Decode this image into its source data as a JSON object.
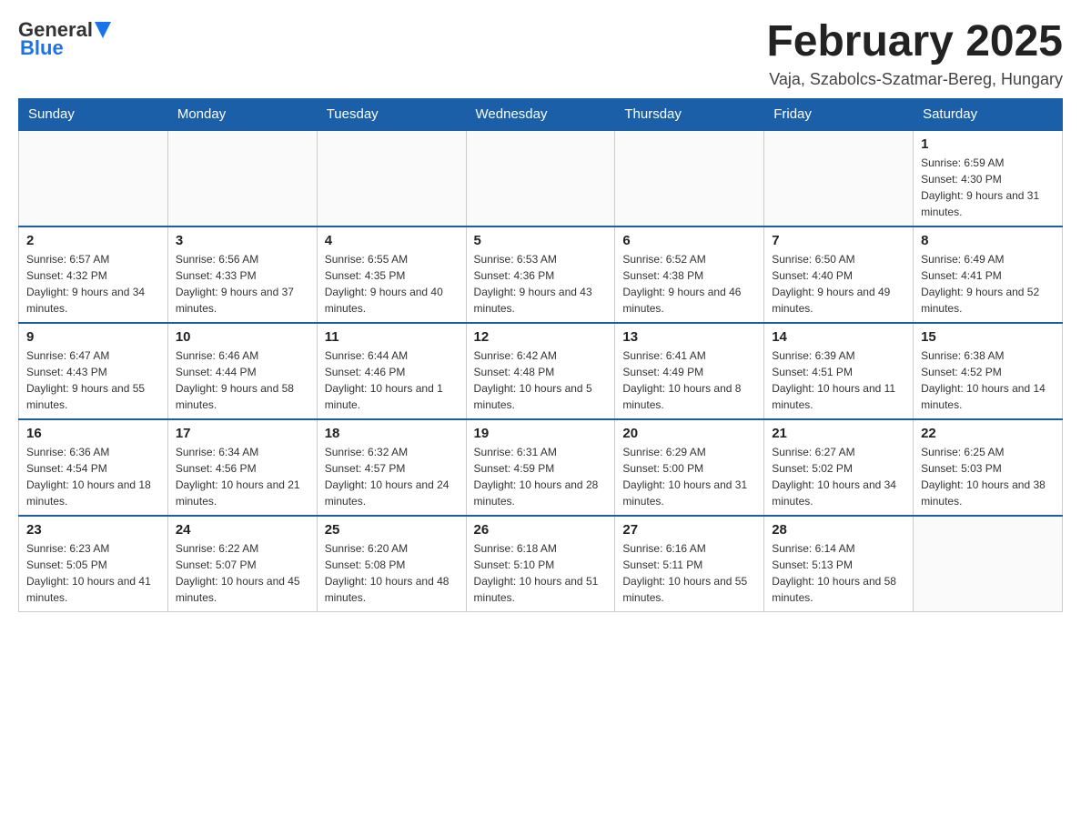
{
  "header": {
    "logo": {
      "general": "General",
      "blue": "Blue"
    },
    "title": "February 2025",
    "location": "Vaja, Szabolcs-Szatmar-Bereg, Hungary"
  },
  "days_of_week": [
    "Sunday",
    "Monday",
    "Tuesday",
    "Wednesday",
    "Thursday",
    "Friday",
    "Saturday"
  ],
  "weeks": [
    [
      {
        "day": "",
        "info": ""
      },
      {
        "day": "",
        "info": ""
      },
      {
        "day": "",
        "info": ""
      },
      {
        "day": "",
        "info": ""
      },
      {
        "day": "",
        "info": ""
      },
      {
        "day": "",
        "info": ""
      },
      {
        "day": "1",
        "info": "Sunrise: 6:59 AM\nSunset: 4:30 PM\nDaylight: 9 hours and 31 minutes."
      }
    ],
    [
      {
        "day": "2",
        "info": "Sunrise: 6:57 AM\nSunset: 4:32 PM\nDaylight: 9 hours and 34 minutes."
      },
      {
        "day": "3",
        "info": "Sunrise: 6:56 AM\nSunset: 4:33 PM\nDaylight: 9 hours and 37 minutes."
      },
      {
        "day": "4",
        "info": "Sunrise: 6:55 AM\nSunset: 4:35 PM\nDaylight: 9 hours and 40 minutes."
      },
      {
        "day": "5",
        "info": "Sunrise: 6:53 AM\nSunset: 4:36 PM\nDaylight: 9 hours and 43 minutes."
      },
      {
        "day": "6",
        "info": "Sunrise: 6:52 AM\nSunset: 4:38 PM\nDaylight: 9 hours and 46 minutes."
      },
      {
        "day": "7",
        "info": "Sunrise: 6:50 AM\nSunset: 4:40 PM\nDaylight: 9 hours and 49 minutes."
      },
      {
        "day": "8",
        "info": "Sunrise: 6:49 AM\nSunset: 4:41 PM\nDaylight: 9 hours and 52 minutes."
      }
    ],
    [
      {
        "day": "9",
        "info": "Sunrise: 6:47 AM\nSunset: 4:43 PM\nDaylight: 9 hours and 55 minutes."
      },
      {
        "day": "10",
        "info": "Sunrise: 6:46 AM\nSunset: 4:44 PM\nDaylight: 9 hours and 58 minutes."
      },
      {
        "day": "11",
        "info": "Sunrise: 6:44 AM\nSunset: 4:46 PM\nDaylight: 10 hours and 1 minute."
      },
      {
        "day": "12",
        "info": "Sunrise: 6:42 AM\nSunset: 4:48 PM\nDaylight: 10 hours and 5 minutes."
      },
      {
        "day": "13",
        "info": "Sunrise: 6:41 AM\nSunset: 4:49 PM\nDaylight: 10 hours and 8 minutes."
      },
      {
        "day": "14",
        "info": "Sunrise: 6:39 AM\nSunset: 4:51 PM\nDaylight: 10 hours and 11 minutes."
      },
      {
        "day": "15",
        "info": "Sunrise: 6:38 AM\nSunset: 4:52 PM\nDaylight: 10 hours and 14 minutes."
      }
    ],
    [
      {
        "day": "16",
        "info": "Sunrise: 6:36 AM\nSunset: 4:54 PM\nDaylight: 10 hours and 18 minutes."
      },
      {
        "day": "17",
        "info": "Sunrise: 6:34 AM\nSunset: 4:56 PM\nDaylight: 10 hours and 21 minutes."
      },
      {
        "day": "18",
        "info": "Sunrise: 6:32 AM\nSunset: 4:57 PM\nDaylight: 10 hours and 24 minutes."
      },
      {
        "day": "19",
        "info": "Sunrise: 6:31 AM\nSunset: 4:59 PM\nDaylight: 10 hours and 28 minutes."
      },
      {
        "day": "20",
        "info": "Sunrise: 6:29 AM\nSunset: 5:00 PM\nDaylight: 10 hours and 31 minutes."
      },
      {
        "day": "21",
        "info": "Sunrise: 6:27 AM\nSunset: 5:02 PM\nDaylight: 10 hours and 34 minutes."
      },
      {
        "day": "22",
        "info": "Sunrise: 6:25 AM\nSunset: 5:03 PM\nDaylight: 10 hours and 38 minutes."
      }
    ],
    [
      {
        "day": "23",
        "info": "Sunrise: 6:23 AM\nSunset: 5:05 PM\nDaylight: 10 hours and 41 minutes."
      },
      {
        "day": "24",
        "info": "Sunrise: 6:22 AM\nSunset: 5:07 PM\nDaylight: 10 hours and 45 minutes."
      },
      {
        "day": "25",
        "info": "Sunrise: 6:20 AM\nSunset: 5:08 PM\nDaylight: 10 hours and 48 minutes."
      },
      {
        "day": "26",
        "info": "Sunrise: 6:18 AM\nSunset: 5:10 PM\nDaylight: 10 hours and 51 minutes."
      },
      {
        "day": "27",
        "info": "Sunrise: 6:16 AM\nSunset: 5:11 PM\nDaylight: 10 hours and 55 minutes."
      },
      {
        "day": "28",
        "info": "Sunrise: 6:14 AM\nSunset: 5:13 PM\nDaylight: 10 hours and 58 minutes."
      },
      {
        "day": "",
        "info": ""
      }
    ]
  ]
}
